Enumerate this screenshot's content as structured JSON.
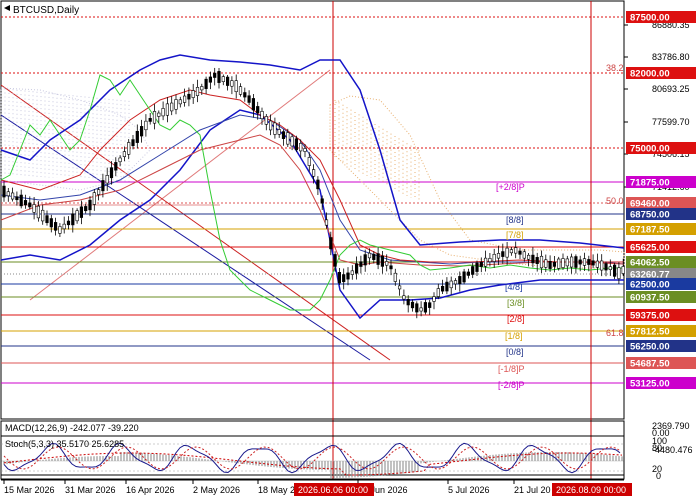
{
  "symbol": "BTCUSD,Daily",
  "colors": {
    "background": "#ffffff",
    "candle": "#000000",
    "bollinger": "#1414c8",
    "ichimoku_cloud": "#e8b070",
    "ichimoku_cloud2": "#c8c8e0",
    "green_line": "#33cc33",
    "red_line": "#cc2222",
    "macd_hist": "#999999",
    "macd_signal": "#cc0000",
    "stoch_main": "#1a1a8c",
    "stoch_signal": "#cc2222",
    "sep_red": "#cc0000"
  },
  "price_axis": {
    "ticks": [
      "86880.35",
      "83786.80",
      "80693.25",
      "77599.70",
      "74506.15",
      "71412.60"
    ],
    "badges": [
      {
        "text": "87500.00",
        "color": "#dd1010"
      },
      {
        "text": "82000.00",
        "color": "#dd1010"
      },
      {
        "text": "75000.00",
        "color": "#dd1010"
      },
      {
        "text": "71875.00",
        "color": "#cc00cc"
      },
      {
        "text": "69460.00",
        "color": "#dd5555"
      },
      {
        "text": "68750.00",
        "color": "#223388"
      },
      {
        "text": "67187.50",
        "color": "#d4a000"
      },
      {
        "text": "65625.00",
        "color": "#dd1010"
      },
      {
        "text": "64062.50",
        "color": "#6b8e23"
      },
      {
        "text": "63260.77",
        "color": "#888888"
      },
      {
        "text": "62500.00",
        "color": "#1a3aa0"
      },
      {
        "text": "60937.50",
        "color": "#6b8e23"
      },
      {
        "text": "59375.00",
        "color": "#dd1010"
      },
      {
        "text": "57812.50",
        "color": "#d4a000"
      },
      {
        "text": "56250.00",
        "color": "#223388"
      },
      {
        "text": "54687.50",
        "color": "#dd5555"
      },
      {
        "text": "53125.00",
        "color": "#cc00cc"
      }
    ]
  },
  "murrey_labels": [
    "[+2/8]P",
    "[8/8]",
    "[7/8]",
    "[4/8]",
    "[3/8]",
    "[2/8]",
    "[1/8]",
    "[0/8]",
    "[-1/8]P",
    "[-2/8]P"
  ],
  "fib_labels": [
    "38.2",
    "50.0",
    "61.8"
  ],
  "macd": {
    "label": "MACD(12,26,9) -242.077 -39.220",
    "ticks": [
      "2369.790",
      "0.00",
      "-4480.476"
    ]
  },
  "stoch": {
    "label": "Stoch(5,3,3) 35.5170 25.6285",
    "ticks": [
      "100",
      "80",
      "20",
      "0"
    ]
  },
  "date_axis": {
    "labels": [
      "15 Mar 2026",
      "31 Mar 2026",
      "16 Apr 2026",
      "2 May 2026",
      "18 May 2",
      "19 Jun 2026",
      "5 Jul 2026",
      "21 Jul 20"
    ],
    "highlights": [
      "2026.06.06 00:00",
      "2026.08.09 00:00"
    ]
  }
}
